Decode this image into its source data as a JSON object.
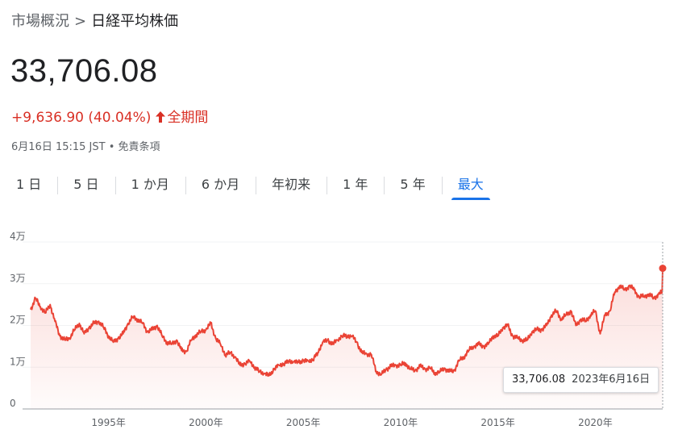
{
  "breadcrumb": {
    "parent": "市場概況",
    "separator": ">",
    "current": "日経平均株価"
  },
  "quote": {
    "price": "33,706.08",
    "change": "+9,636.90 (40.04%)",
    "period": "全期間",
    "timestamp": "6月16日 15:15 JST",
    "bullet": "•",
    "disclaimer": "免責条項"
  },
  "tabs": [
    "1 日",
    "5 日",
    "1 か月",
    "6 か月",
    "年初来",
    "1 年",
    "5 年",
    "最大"
  ],
  "active_tab": "最大",
  "tooltip": {
    "value": "33,706.08",
    "date": "2023年6月16日"
  },
  "colors": {
    "line": "#ea4335",
    "accent": "#1a73e8",
    "negative_text": "#d93025",
    "grid": "#f1f3f4"
  },
  "icons": {
    "change_arrow": "arrow-up-icon"
  },
  "chart_data": {
    "type": "area",
    "ylim": [
      0,
      40000
    ],
    "xlim": [
      1991.0,
      2023.46
    ],
    "yticks": [
      {
        "value": 0,
        "label": "0"
      },
      {
        "value": 10000,
        "label": "1万"
      },
      {
        "value": 20000,
        "label": "2万"
      },
      {
        "value": 30000,
        "label": "3万"
      },
      {
        "value": 40000,
        "label": "4万"
      }
    ],
    "xticks": [
      {
        "value": 1995,
        "label": "1995年"
      },
      {
        "value": 2000,
        "label": "2000年"
      },
      {
        "value": 2005,
        "label": "2005年"
      },
      {
        "value": 2010,
        "label": "2010年"
      },
      {
        "value": 2015,
        "label": "2015年"
      },
      {
        "value": 2020,
        "label": "2020年"
      }
    ],
    "grid": true,
    "x": [
      1991.0,
      1991.25,
      1991.5,
      1991.75,
      1992.0,
      1992.25,
      1992.5,
      1992.75,
      1993.0,
      1993.25,
      1993.5,
      1993.75,
      1994.0,
      1994.25,
      1994.5,
      1994.75,
      1995.0,
      1995.25,
      1995.5,
      1995.75,
      1996.0,
      1996.25,
      1996.5,
      1996.75,
      1997.0,
      1997.25,
      1997.5,
      1997.75,
      1998.0,
      1998.25,
      1998.5,
      1998.75,
      1999.0,
      1999.25,
      1999.5,
      1999.75,
      2000.0,
      2000.25,
      2000.5,
      2000.75,
      2001.0,
      2001.25,
      2001.5,
      2001.75,
      2002.0,
      2002.25,
      2002.5,
      2002.75,
      2003.0,
      2003.25,
      2003.5,
      2003.75,
      2004.0,
      2004.25,
      2004.5,
      2004.75,
      2005.0,
      2005.25,
      2005.5,
      2005.75,
      2006.0,
      2006.25,
      2006.5,
      2006.75,
      2007.0,
      2007.25,
      2007.5,
      2007.75,
      2008.0,
      2008.25,
      2008.5,
      2008.75,
      2009.0,
      2009.25,
      2009.5,
      2009.75,
      2010.0,
      2010.25,
      2010.5,
      2010.75,
      2011.0,
      2011.25,
      2011.5,
      2011.75,
      2012.0,
      2012.25,
      2012.5,
      2012.75,
      2013.0,
      2013.25,
      2013.5,
      2013.75,
      2014.0,
      2014.25,
      2014.5,
      2014.75,
      2015.0,
      2015.25,
      2015.5,
      2015.75,
      2016.0,
      2016.25,
      2016.5,
      2016.75,
      2017.0,
      2017.25,
      2017.5,
      2017.75,
      2018.0,
      2018.25,
      2018.5,
      2018.75,
      2019.0,
      2019.25,
      2019.5,
      2019.75,
      2020.0,
      2020.25,
      2020.5,
      2020.75,
      2021.0,
      2021.25,
      2021.5,
      2021.75,
      2022.0,
      2022.25,
      2022.5,
      2022.75,
      2023.0,
      2023.25,
      2023.46
    ],
    "values": [
      23800,
      26500,
      24500,
      23000,
      25000,
      21000,
      17500,
      16500,
      17000,
      19000,
      20500,
      18000,
      19500,
      20500,
      21000,
      19500,
      17500,
      16000,
      17000,
      18000,
      20500,
      22000,
      21500,
      20500,
      18500,
      19000,
      20000,
      17500,
      16000,
      15500,
      16500,
      14000,
      13800,
      16500,
      17800,
      18500,
      19000,
      20500,
      17000,
      15500,
      13000,
      13500,
      12500,
      10500,
      10800,
      11500,
      10000,
      9000,
      8500,
      8000,
      9500,
      10500,
      10800,
      11500,
      11300,
      11200,
      11500,
      11500,
      11800,
      13500,
      16000,
      16500,
      15500,
      16500,
      17500,
      17500,
      17500,
      16000,
      13500,
      13200,
      13000,
      9000,
      8200,
      9500,
      10200,
      10500,
      10500,
      11000,
      9500,
      9300,
      10200,
      9600,
      9800,
      8700,
      8800,
      9800,
      8900,
      9200,
      11500,
      12500,
      14000,
      15000,
      15500,
      15000,
      15500,
      17500,
      17500,
      19500,
      20000,
      17500,
      17000,
      16500,
      16500,
      18500,
      19000,
      19000,
      20000,
      22500,
      23500,
      21500,
      22500,
      23500,
      20000,
      21500,
      21000,
      22500,
      23500,
      18000,
      22500,
      23500,
      28000,
      29500,
      28500,
      29500,
      28500,
      26800,
      27000,
      27500,
      26500,
      27500,
      28000,
      31000,
      33706.08
    ]
  }
}
